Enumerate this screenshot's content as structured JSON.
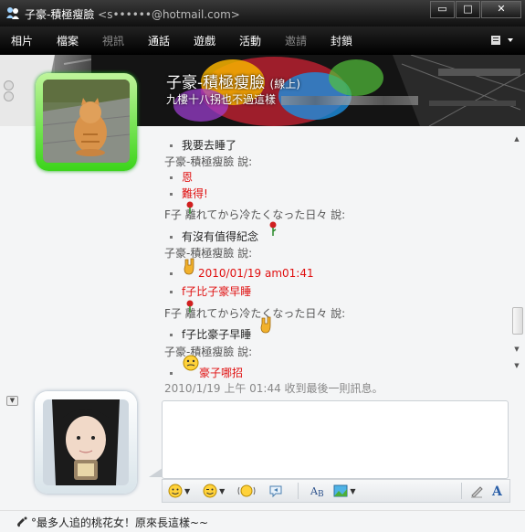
{
  "window": {
    "title": "子豪-積極瘦臉",
    "title_email": "<s••••••@hotmail.com>",
    "buttons": [
      "▭",
      "□",
      "✕"
    ]
  },
  "menu": [
    {
      "label": "相片",
      "enabled": true
    },
    {
      "label": "檔案",
      "enabled": true
    },
    {
      "label": "視訊",
      "enabled": false
    },
    {
      "label": "通話",
      "enabled": true
    },
    {
      "label": "遊戲",
      "enabled": true
    },
    {
      "label": "活動",
      "enabled": true
    },
    {
      "label": "邀請",
      "enabled": false
    },
    {
      "label": "封鎖",
      "enabled": true
    }
  ],
  "contact": {
    "name": "子豪-積極瘦臉",
    "status": "(線上)",
    "personal_message": "九樓十八拐也不過這樣"
  },
  "conversation": {
    "lines": [
      {
        "kind": "msg",
        "text": "我要去睡了"
      },
      {
        "kind": "sender",
        "text": "子豪-積極瘦臉 說:"
      },
      {
        "kind": "msg",
        "text": "恩",
        "color": "#e01010"
      },
      {
        "kind": "msg",
        "text": "難得!",
        "color": "#e01010"
      },
      {
        "kind": "sender",
        "text": "F子 離れてから冷たくなった日々 說:"
      },
      {
        "kind": "msg",
        "text": "有沒有值得紀念"
      },
      {
        "kind": "sender",
        "text": "子豪-積極瘦臉 說:"
      },
      {
        "kind": "msg",
        "text": "2010/01/19  am01:41",
        "color": "#e01010"
      },
      {
        "kind": "msg",
        "text": "f子比子豪早睡",
        "color": "#e01010"
      },
      {
        "kind": "sender",
        "text": "F子 離れてから冷たくなった日々 說:"
      },
      {
        "kind": "msg",
        "text": "f子比豪子早睡"
      },
      {
        "kind": "sender",
        "text": "子豪-積極瘦臉 說:"
      },
      {
        "kind": "msg",
        "text": "豪子哪招",
        "color": "#e01010"
      },
      {
        "kind": "timestamp",
        "text": "2010/1/19 上午 01:44 收到最後一則訊息。"
      }
    ]
  },
  "status_bar": {
    "text": "°最多人追的桃花女！原來長這樣~~"
  },
  "icons": {
    "app": "messenger-icon",
    "emoticon": "smiley-icon",
    "wink": "wink-icon",
    "nudge": "nudge-icon",
    "voice_clip": "voice-clip-icon",
    "font": "font-icon",
    "background": "background-icon",
    "handwriting": "pen-icon",
    "text_mode": "text-icon"
  },
  "colors": {
    "accent_red": "#e01010",
    "online_frame": "#3bd41a"
  }
}
